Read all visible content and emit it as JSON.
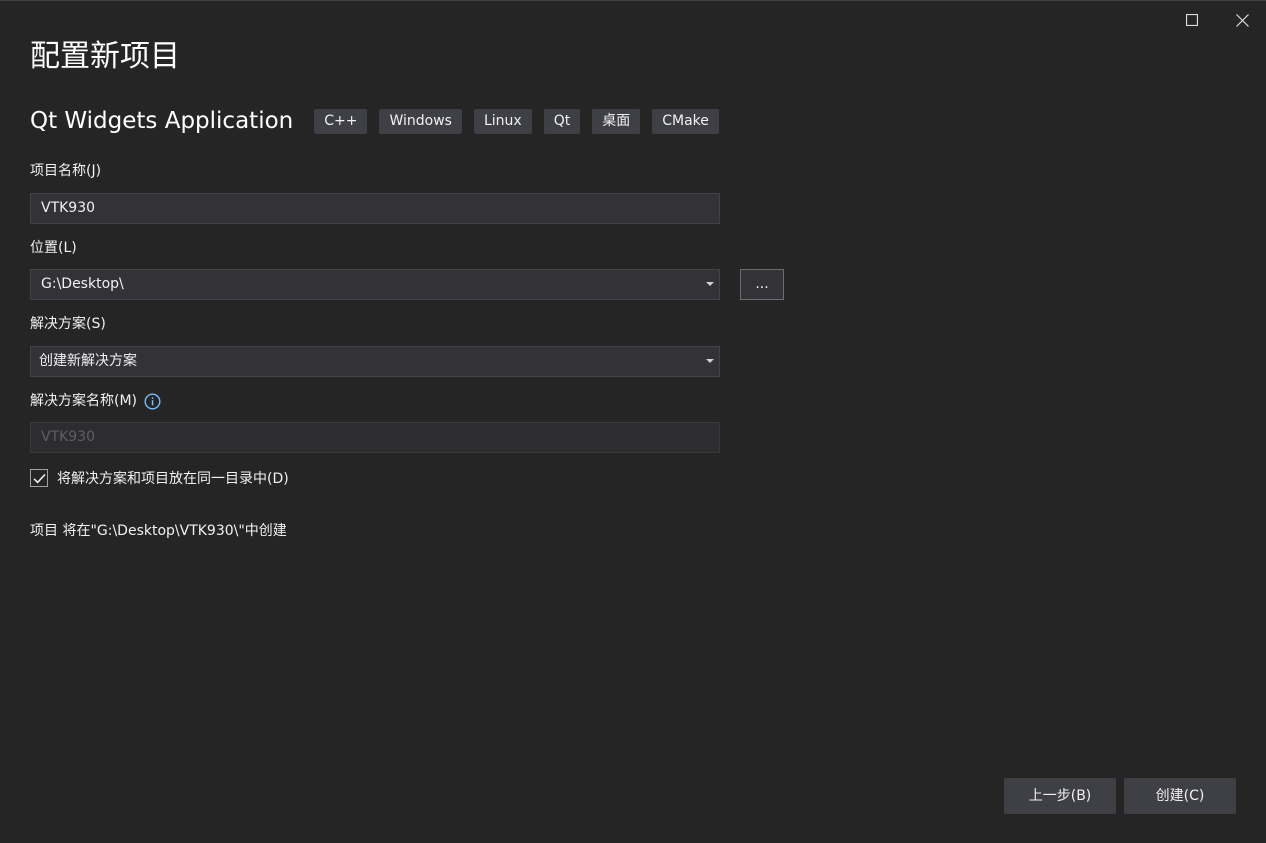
{
  "window": {
    "title": "配置新项目"
  },
  "template": {
    "name": "Qt Widgets Application",
    "tags": [
      "C++",
      "Windows",
      "Linux",
      "Qt",
      "桌面",
      "CMake"
    ]
  },
  "project_name": {
    "label": "项目名称(J)",
    "value": "VTK930"
  },
  "location": {
    "label": "位置(L)",
    "value": "G:\\Desktop\\",
    "browse_label": "..."
  },
  "solution": {
    "label": "解决方案(S)",
    "value": "创建新解决方案"
  },
  "solution_name": {
    "label": "解决方案名称(M)",
    "value": "VTK930"
  },
  "same_dir": {
    "label": "将解决方案和项目放在同一目录中(D)",
    "checked": true
  },
  "summary": "项目 将在\"G:\\Desktop\\VTK930\\\"中创建",
  "footer": {
    "back_label": "上一步(B)",
    "create_label": "创建(C)"
  },
  "colors": {
    "background": "#252526",
    "input_background": "#333337",
    "tag_background": "#3f3f46",
    "info_icon": "#75beff"
  }
}
